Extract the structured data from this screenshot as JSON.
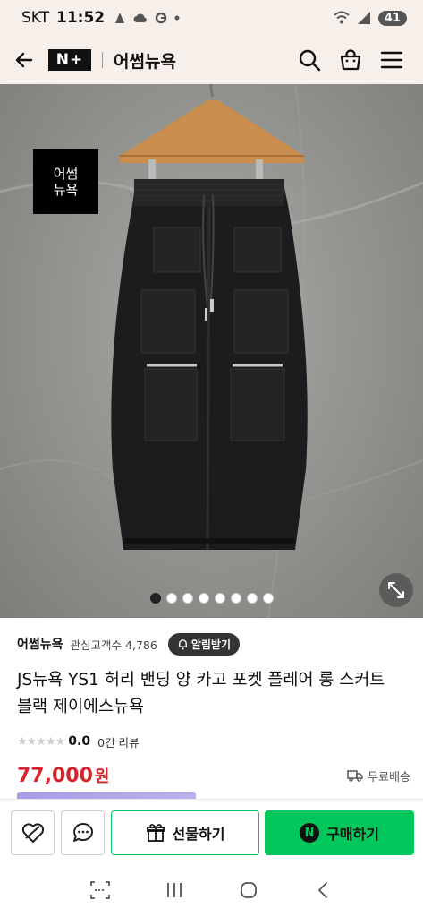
{
  "status_bar": {
    "carrier": "SKT",
    "time": "11:52",
    "battery": "41"
  },
  "header": {
    "brand_logo": "N+",
    "store_title": "어썸뉴욕"
  },
  "hero": {
    "watermark_line1": "어썸",
    "watermark_line2": "뉴욕",
    "image_count": 8,
    "active_index": 0
  },
  "store": {
    "name": "어썸뉴욕",
    "fans_label": "관심고객수",
    "fans_count": "4,786",
    "alarm_button": "알림받기"
  },
  "product": {
    "title_line1": "JS뉴욕 YS1 허리 밴딩 양 카고 포켓 플레어 롱 스커트",
    "title_line2": "블랙 제이에스뉴욕",
    "rating": "0.0",
    "review_count": "0건 리뷰",
    "price": "77,000",
    "currency": "원",
    "shipping": "무료배송"
  },
  "actions": {
    "gift_label": "선물하기",
    "buy_label": "구매하기",
    "buy_badge": "N"
  },
  "colors": {
    "header_bg": "#f6efea",
    "price_red": "#d8232a",
    "naver_green": "#03c75a"
  }
}
